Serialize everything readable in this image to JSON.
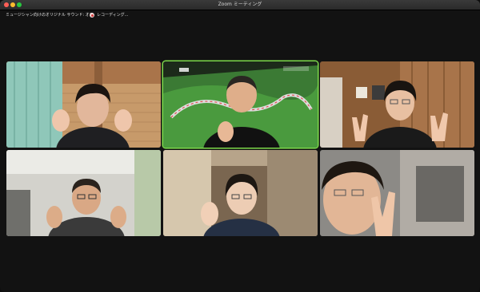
{
  "window": {
    "title": "Zoom ミーティング"
  },
  "status": {
    "audio_mode": "ミュージシャン向けのオリジナル サウンド: オフ",
    "recording": "レコーディング..."
  },
  "participants": [
    {
      "row": 1,
      "col": 1,
      "gesture": "waving-both-hands",
      "active": false
    },
    {
      "row": 1,
      "col": 2,
      "gesture": "thumbs-up",
      "active": true,
      "background": "virtual-racetrack"
    },
    {
      "row": 1,
      "col": 3,
      "gesture": "peace-signs",
      "active": false
    },
    {
      "row": 2,
      "col": 1,
      "gesture": "thumbs-up-both-hands",
      "active": false
    },
    {
      "row": 2,
      "col": 2,
      "gesture": "waving",
      "active": false
    },
    {
      "row": 2,
      "col": 3,
      "gesture": "peace-sign",
      "active": false
    }
  ],
  "colors": {
    "active_speaker_border": "#7cd94a",
    "recording_indicator": "#d23b3b"
  }
}
